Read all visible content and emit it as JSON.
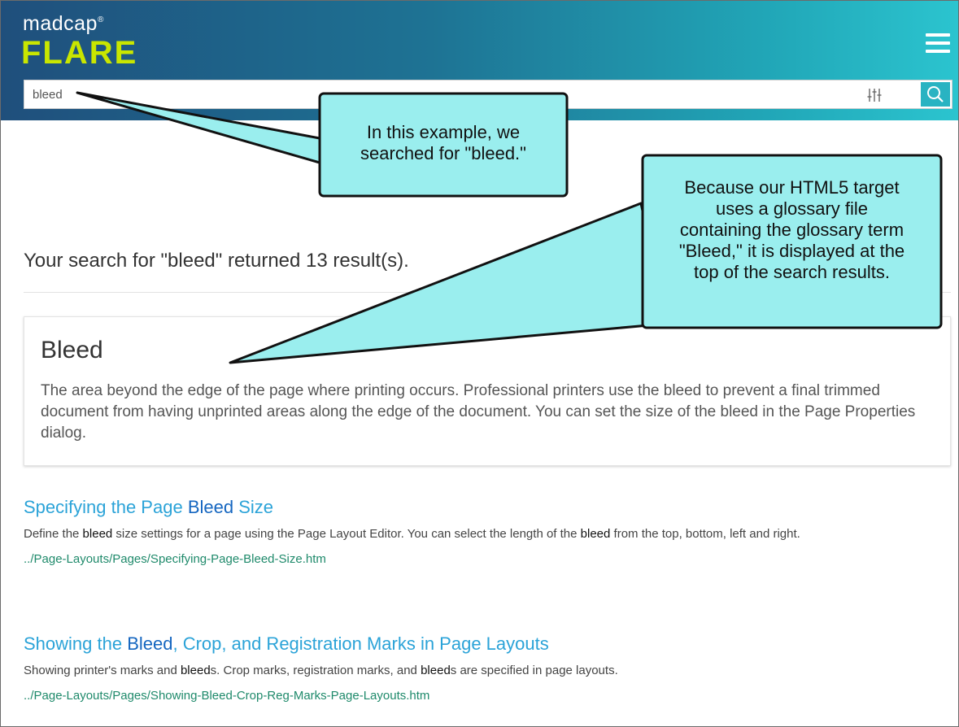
{
  "header": {
    "logo_top": "madcap",
    "logo_reg": "®",
    "logo_main": "FLARE",
    "menu_icon": "hamburger-menu-icon",
    "colors": {
      "gradient_start": "#1f4f7c",
      "gradient_end": "#2bc4cf",
      "logo_accent": "#c9e600"
    }
  },
  "search": {
    "value": "bleed",
    "filter_icon": "sliders-filter-icon",
    "submit_icon": "search-icon"
  },
  "results": {
    "summary": "Your search for \"bleed\" returned 13 result(s).",
    "glossary": {
      "term": "Bleed",
      "definition": "The area beyond the edge of the page where printing occurs. Professional printers use the bleed to prevent a final trimmed document from having unprinted areas along the edge of the document. You can set the size of the bleed in the Page Properties dialog."
    },
    "items": [
      {
        "title_pre": "Specifying the Page ",
        "title_hl": "Bleed",
        "title_post": " Size",
        "desc_1": "Define the ",
        "desc_b1": "bleed",
        "desc_2": " size settings for a page using the Page Layout Editor. You can select the length of the ",
        "desc_b2": "bleed",
        "desc_3": " from the top, bottom, left and right.",
        "url": "../Page-Layouts/Pages/Specifying-Page-Bleed-Size.htm"
      },
      {
        "title_pre": "Showing the ",
        "title_hl": "Bleed",
        "title_post": ", Crop, and Registration Marks in Page Layouts",
        "desc_1": "Showing printer's marks and ",
        "desc_b1": "bleed",
        "desc_2": "s. Crop marks, registration marks, and ",
        "desc_b2": "bleed",
        "desc_3": "s are specified in page layouts.",
        "url": "../Page-Layouts/Pages/Showing-Bleed-Crop-Reg-Marks-Page-Layouts.htm"
      }
    ],
    "colors": {
      "title": "#2ba3d8",
      "highlight": "#1566c0",
      "url": "#1f8a6b"
    }
  },
  "callouts": [
    {
      "line1": "In this example, we",
      "line2": "searched for \"bleed.\""
    },
    {
      "line1": "Because our HTML5 target",
      "line2": "uses a glossary file",
      "line3": "containing the glossary term",
      "line4": "\"Bleed,\" it is displayed at the",
      "line5": "top of the search results."
    }
  ],
  "callout_color": "#9aeeee"
}
